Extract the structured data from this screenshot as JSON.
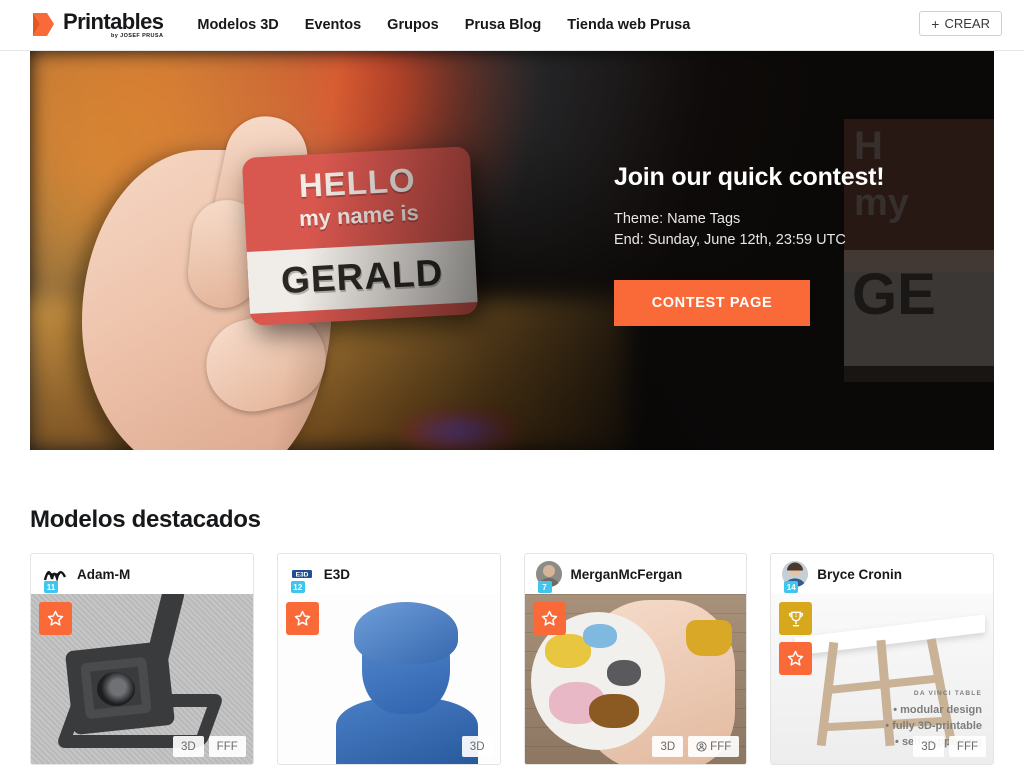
{
  "header": {
    "logo": {
      "word": "Printables",
      "sub": "by JOSEF PRUSA",
      "icon": "printables-arrow-icon"
    },
    "nav": [
      {
        "label": "Modelos 3D"
      },
      {
        "label": "Eventos"
      },
      {
        "label": "Grupos"
      },
      {
        "label": "Prusa Blog"
      },
      {
        "label": "Tienda web Prusa"
      }
    ],
    "create_button": {
      "plus": "+",
      "label": "CREAR"
    }
  },
  "hero": {
    "title": "Join our quick contest!",
    "theme_line": "Theme: Name Tags",
    "end_line": "End: Sunday, June 12th, 23:59 UTC",
    "cta_label": "CONTEST PAGE",
    "photo": {
      "alt": "Hand holding a 3D printed name tag",
      "tag_hello": "HELLO",
      "tag_name_is": "my name is",
      "tag_given_name": "GERALD"
    }
  },
  "featured": {
    "title": "Modelos destacados",
    "cards": [
      {
        "user": "Adam-M",
        "level": "11",
        "avatar_icon": "signature-avatar-icon",
        "badges": [
          "star-icon"
        ],
        "chips": [
          {
            "label": "3D"
          },
          {
            "label": "FFF"
          }
        ],
        "art": "gimbal-camera-mount"
      },
      {
        "user": "E3D",
        "level": "12",
        "avatar_icon": "e3d-logo-avatar-icon",
        "badges": [
          "star-icon"
        ],
        "chips": [
          {
            "label": "3D"
          }
        ],
        "art": "blue-scanned-bust"
      },
      {
        "user": "MerganMcFergan",
        "level": "7",
        "avatar_icon": "person-photo-avatar-icon",
        "badges": [
          "star-icon"
        ],
        "chips": [
          {
            "label": "3D"
          },
          {
            "label": "FFF",
            "icon": "person-circle-icon"
          }
        ],
        "art": "paint-palette-in-hand"
      },
      {
        "user": "Bryce Cronin",
        "level": "14",
        "avatar_icon": "person-photo-avatar-icon",
        "badges": [
          "trophy-icon",
          "star-icon"
        ],
        "chips": [
          {
            "label": "3D"
          },
          {
            "label": "FFF"
          }
        ],
        "art": "da-vinci-table",
        "art_caption": {
          "title": "DA VINCI TABLE",
          "lines": [
            "• modular design",
            "• fully 3D-printable",
            "• self-supporting"
          ]
        }
      }
    ]
  },
  "colors": {
    "accent_orange": "#fa6a38",
    "trophy_gold": "#d7a81b",
    "level_blue": "#3ec6ef",
    "text_dark": "#17181a"
  }
}
